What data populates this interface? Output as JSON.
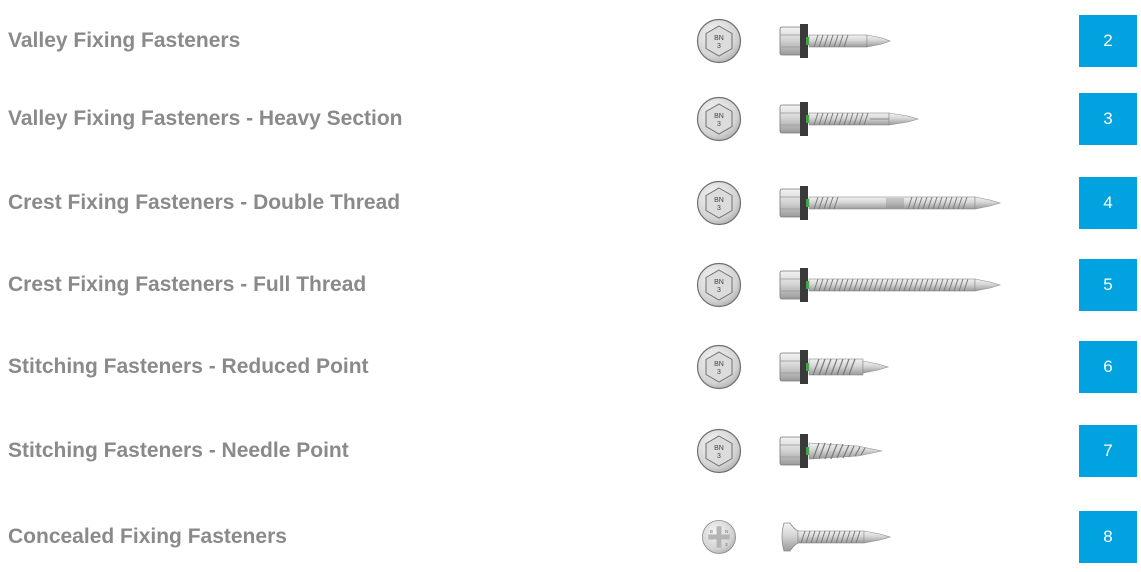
{
  "head_marking": {
    "line1": "BN",
    "line2": "3"
  },
  "concealed_head_marking": {
    "chars": [
      "B",
      "N",
      "3"
    ]
  },
  "colors": {
    "badge": "#00a3e0",
    "title": "#8a8a8a",
    "washer": "#3a3a3a",
    "washer_ring": "#3aa845",
    "steel_light": "#e4e4e4",
    "steel_dark": "#8d8d8d"
  },
  "items": [
    {
      "title": "Valley Fixing Fasteners",
      "page": "2",
      "icon": "hex-head-screw-short-icon"
    },
    {
      "title": "Valley Fixing Fasteners - Heavy Section",
      "page": "3",
      "icon": "hex-head-screw-heavy-icon"
    },
    {
      "title": "Crest Fixing Fasteners - Double Thread",
      "page": "4",
      "icon": "hex-head-screw-double-thread-icon"
    },
    {
      "title": "Crest Fixing Fasteners - Full Thread",
      "page": "5",
      "icon": "hex-head-screw-full-thread-icon"
    },
    {
      "title": "Stitching Fasteners - Reduced Point",
      "page": "6",
      "icon": "hex-head-screw-reduced-point-icon"
    },
    {
      "title": "Stitching Fasteners - Needle Point",
      "page": "7",
      "icon": "hex-head-screw-needle-point-icon"
    },
    {
      "title": "Concealed Fixing Fasteners",
      "page": "8",
      "icon": "wafer-head-screw-icon"
    }
  ]
}
